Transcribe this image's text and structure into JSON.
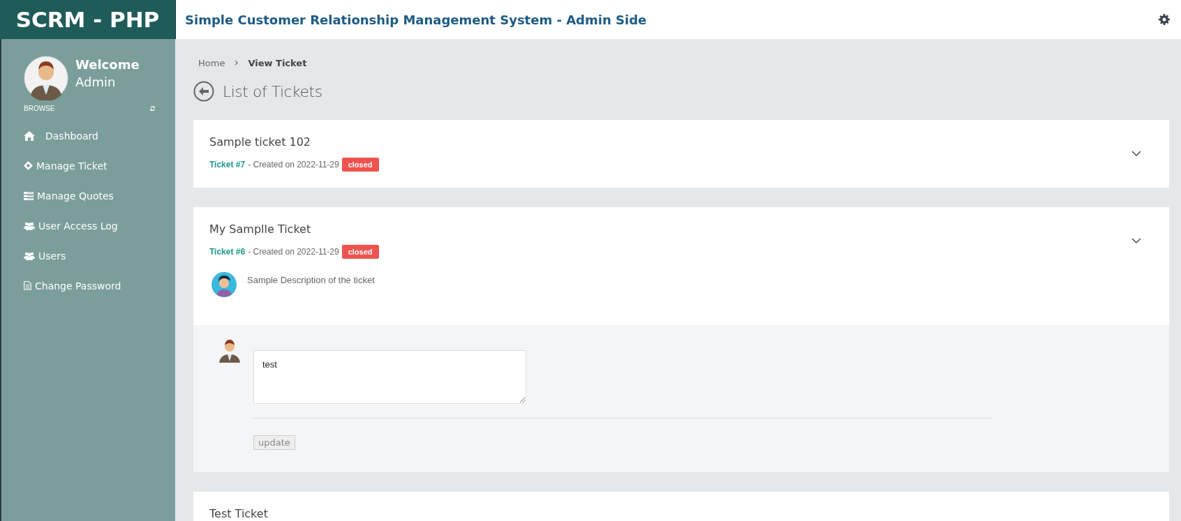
{
  "brand": "SCRM - PHP",
  "header": {
    "title": "Simple Customer Relationship Management System - Admin Side"
  },
  "sidebar": {
    "welcome": "Welcome",
    "user": "Admin",
    "section": "BROWSE",
    "items": [
      {
        "label": "Dashboard",
        "kind": "home"
      },
      {
        "label": "Manage Ticket",
        "kind": "ticket"
      },
      {
        "label": "Manage Quotes",
        "kind": "list"
      },
      {
        "label": "User Access Log",
        "kind": "users"
      },
      {
        "label": "Users",
        "kind": "users"
      },
      {
        "label": "Change Password",
        "kind": "file"
      }
    ]
  },
  "breadcrumb": [
    {
      "label": "Home",
      "selected": false
    },
    {
      "label": "View Ticket",
      "selected": true
    }
  ],
  "page_title": "List of Tickets",
  "tickets": [
    {
      "title": "Sample ticket 102",
      "number": "Ticket #7",
      "created": "- Created on 2022-11-29",
      "status": "closed",
      "expanded": false
    },
    {
      "title": "My Samplle Ticket",
      "number": "Ticket #6",
      "created": "- Created on 2022-11-29",
      "status": "closed",
      "expanded": true,
      "description": "Sample Description of the ticket",
      "reply": "test",
      "button": "update"
    },
    {
      "title": "Test Ticket",
      "expanded": false
    }
  ]
}
